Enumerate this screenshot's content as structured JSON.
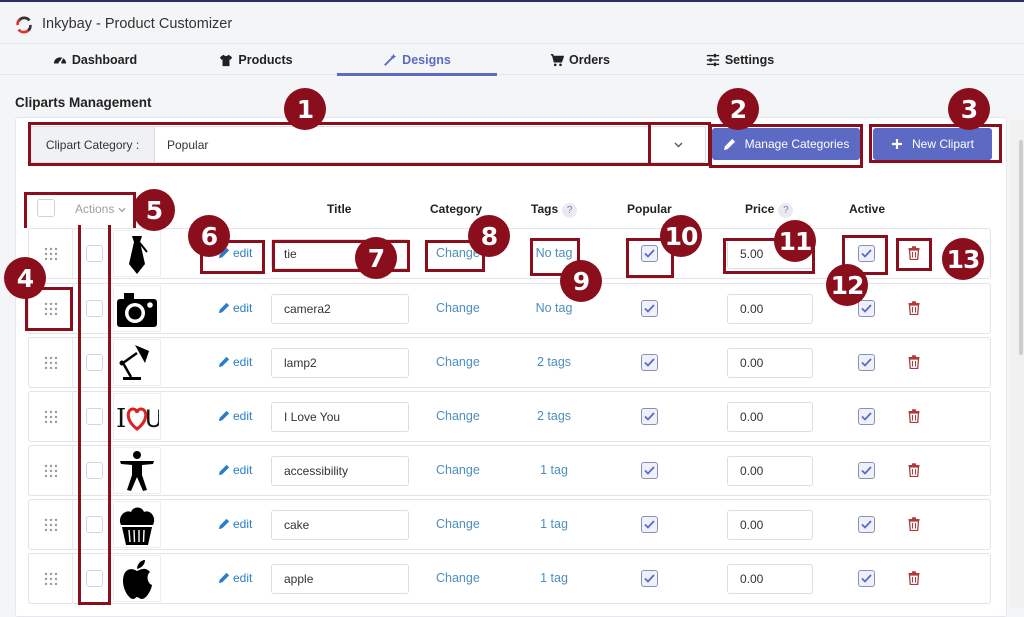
{
  "app": {
    "title": "Inkybay - Product Customizer",
    "accent_color": "#5c6ac4",
    "link_color": "#2a7dc7",
    "danger_color": "#b03a3a",
    "annotation_color": "#8a0e1c"
  },
  "nav": {
    "tabs": [
      {
        "label": "Dashboard",
        "icon": "dashboard-icon",
        "active": false
      },
      {
        "label": "Products",
        "icon": "tshirt-icon",
        "active": false
      },
      {
        "label": "Designs",
        "icon": "magic-wand-icon",
        "active": true
      },
      {
        "label": "Orders",
        "icon": "cart-icon",
        "active": false
      },
      {
        "label": "Settings",
        "icon": "sliders-icon",
        "active": false
      }
    ]
  },
  "page": {
    "section_title": "Cliparts Management"
  },
  "filter": {
    "label": "Clipart Category :",
    "selected": "Popular"
  },
  "buttons": {
    "manage_categories": "Manage Categories",
    "new_clipart": "New Clipart"
  },
  "table": {
    "actions_label": "Actions",
    "headers": {
      "title": "Title",
      "category": "Category",
      "tags": "Tags",
      "tags_help": "?",
      "popular": "Popular",
      "price": "Price",
      "price_help": "?",
      "active": "Active"
    },
    "edit_label": "edit",
    "change_label": "Change",
    "rows": [
      {
        "image": "tie-icon",
        "title": "tie",
        "tags": "No tag",
        "popular": true,
        "price": "5.00",
        "active": true
      },
      {
        "image": "camera-icon",
        "title": "camera2",
        "tags": "No tag",
        "popular": true,
        "price": "0.00",
        "active": true
      },
      {
        "image": "lamp-icon",
        "title": "lamp2",
        "tags": "2 tags",
        "popular": true,
        "price": "0.00",
        "active": true
      },
      {
        "image": "i-love-you-icon",
        "title": "I Love You",
        "tags": "2 tags",
        "popular": true,
        "price": "0.00",
        "active": true
      },
      {
        "image": "accessibility-icon",
        "title": "accessibility",
        "tags": "1 tag",
        "popular": true,
        "price": "0.00",
        "active": true
      },
      {
        "image": "cupcake-icon",
        "title": "cake",
        "tags": "1 tag",
        "popular": true,
        "price": "0.00",
        "active": true
      },
      {
        "image": "apple-icon",
        "title": "apple",
        "tags": "1 tag",
        "popular": true,
        "price": "0.00",
        "active": true
      }
    ]
  },
  "annotations": [
    "1",
    "2",
    "3",
    "4",
    "5",
    "6",
    "7",
    "8",
    "9",
    "10",
    "11",
    "12",
    "13"
  ]
}
